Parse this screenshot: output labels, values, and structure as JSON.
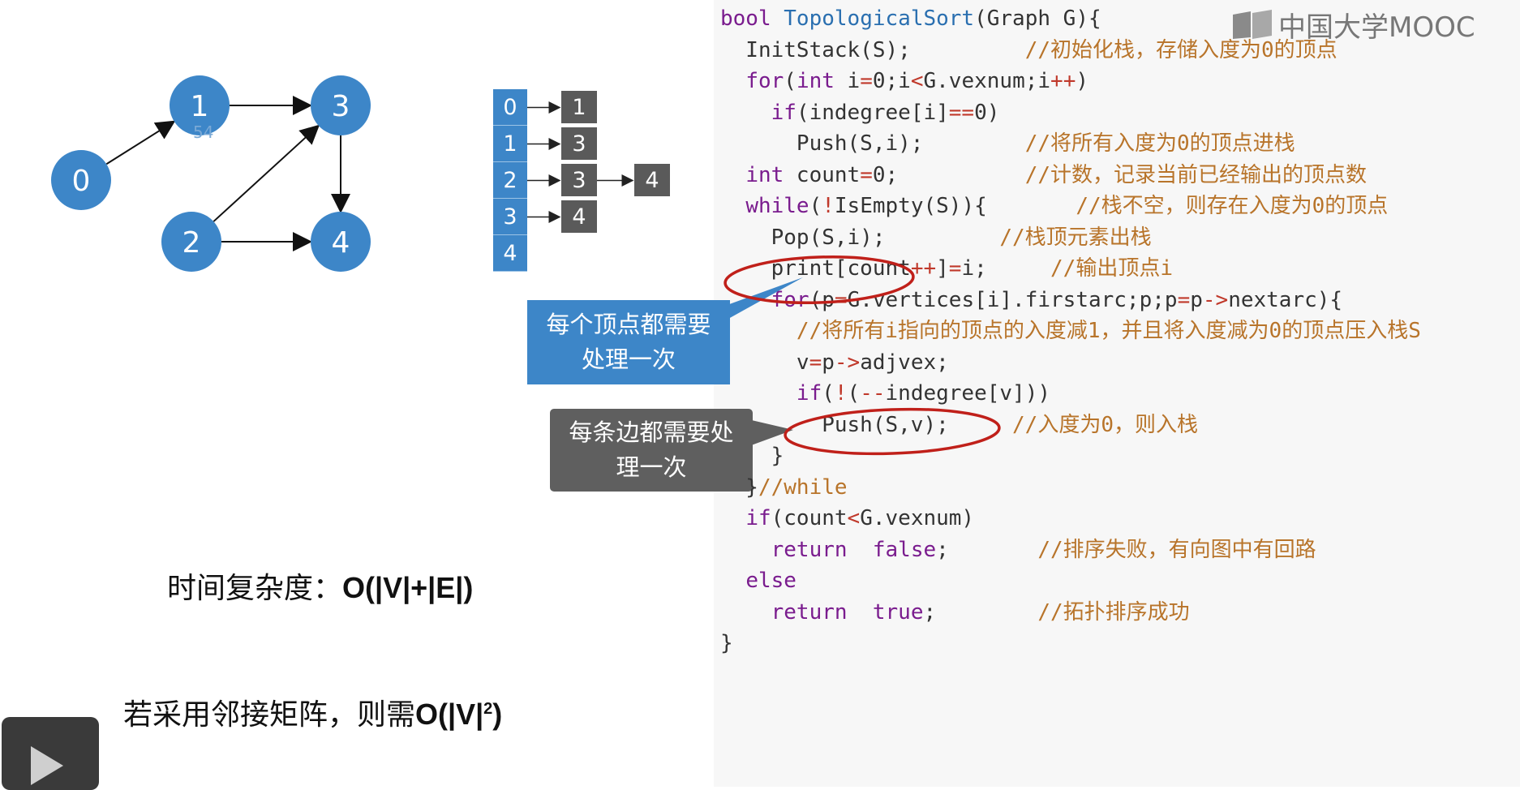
{
  "graph": {
    "nodes": [
      "0",
      "1",
      "2",
      "3",
      "4"
    ],
    "edges": [
      [
        "0",
        "1"
      ],
      [
        "1",
        "3"
      ],
      [
        "2",
        "3"
      ],
      [
        "2",
        "4"
      ],
      [
        "3",
        "4"
      ]
    ],
    "node_color": "#3d86c8",
    "watermark": "54"
  },
  "adjacency_list": {
    "index_color": "#3d86c8",
    "node_color": "#5a5a5a",
    "rows": [
      {
        "index": "0",
        "neighbors": [
          "1"
        ]
      },
      {
        "index": "1",
        "neighbors": [
          "3"
        ]
      },
      {
        "index": "2",
        "neighbors": [
          "3",
          "4"
        ]
      },
      {
        "index": "3",
        "neighbors": [
          "4"
        ]
      },
      {
        "index": "4",
        "neighbors": []
      }
    ]
  },
  "callouts": {
    "vertex": {
      "line1": "每个顶点都需要",
      "line2": "处理一次",
      "color": "#3d86c8"
    },
    "edge": {
      "line1": "每条边都需要处",
      "line2": "理一次",
      "color": "#5f5f5f"
    }
  },
  "complexity": {
    "label": "时间复杂度：",
    "value": "O(|V|+|E|)"
  },
  "matrix_note": {
    "label": "若采用邻接矩阵，则需",
    "value": "O(|V|",
    "sup": "2",
    "close": ")"
  },
  "logo": {
    "text": "中国大学MOOC",
    "icon": "mooc-book-icon"
  },
  "play_button": {
    "icon": "play-icon"
  },
  "code": {
    "lines": [
      "bool TopologicalSort(Graph G){",
      "  InitStack(S);         //初始化栈，存储入度为0的顶点",
      "  for(int i=0;i<G.vexnum;i++)",
      "    if(indegree[i]==0)",
      "      Push(S,i);        //将所有入度为0的顶点进栈",
      "  int count=0;          //计数，记录当前已经输出的顶点数",
      "  while(!IsEmpty(S)){       //栈不空，则存在入度为0的顶点",
      "    Pop(S,i);         //栈顶元素出栈",
      "    print[count++]=i;     //输出顶点i",
      "    for(p=G.vertices[i].firstarc;p;p=p->nextarc){",
      "      //将所有i指向的顶点的入度减1，并且将入度减为0的顶点压入栈S",
      "      v=p->adjvex;",
      "      if(!(--indegree[v]))",
      "        Push(S,v);     //入度为0，则入栈",
      "    }",
      "  }//while",
      "  if(count<G.vexnum)",
      "    return  false;       //排序失败，有向图中有回路",
      "  else",
      "    return  true;        //拓扑排序成功",
      "}"
    ],
    "highlighted": [
      "Pop(S,i);",
      "v=p->adjvex;"
    ],
    "highlight_color": "#c0201a"
  }
}
